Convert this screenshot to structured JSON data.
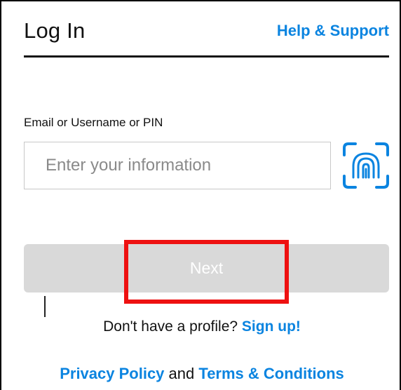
{
  "header": {
    "title": "Log In",
    "help_link": "Help & Support"
  },
  "login_form": {
    "field_label": "Email or Username or PIN",
    "input_value": "",
    "input_placeholder": "Enter your information",
    "biometric_icon": "fingerprint-scan-icon",
    "next_label": "Next"
  },
  "signup": {
    "prompt": "Don't have a profile?",
    "link": "Sign up!"
  },
  "legal": {
    "privacy_link": "Privacy Policy",
    "conjunction": "and",
    "terms_link": "Terms & Conditions"
  },
  "colors": {
    "accent": "#0b84e0",
    "disabled_button": "#d9d9d9",
    "highlight": "#ee1111"
  }
}
